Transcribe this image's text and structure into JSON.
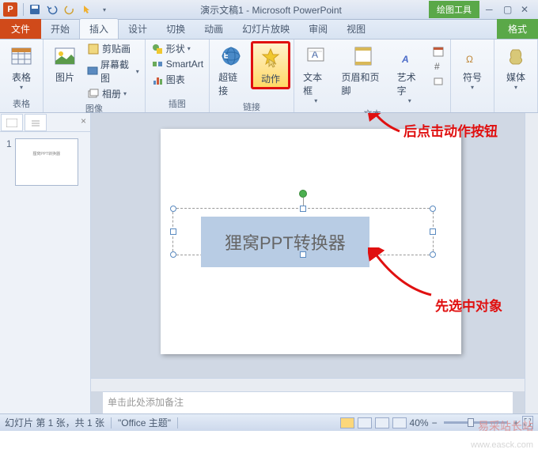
{
  "titlebar": {
    "app_letter": "P",
    "title": "演示文稿1 - Microsoft PowerPoint",
    "drawing_tools": "绘图工具"
  },
  "tabs": {
    "file": "文件",
    "home": "开始",
    "insert": "插入",
    "design": "设计",
    "transitions": "切换",
    "animations": "动画",
    "slideshow": "幻灯片放映",
    "review": "审阅",
    "view": "视图",
    "format": "格式"
  },
  "ribbon": {
    "groups": {
      "tables": {
        "label": "表格",
        "table": "表格"
      },
      "images": {
        "label": "图像",
        "picture": "图片",
        "clipart": "剪贴画",
        "screenshot": "屏幕截图",
        "album": "相册"
      },
      "illustrations": {
        "label": "插图",
        "shapes": "形状",
        "smartart": "SmartArt",
        "chart": "图表"
      },
      "links": {
        "label": "链接",
        "hyperlink": "超链接",
        "action": "动作"
      },
      "text": {
        "label": "文本",
        "textbox": "文本框",
        "headerfooter": "页眉和页脚",
        "wordart": "艺术字"
      },
      "symbols": {
        "label": "",
        "symbol": "符号"
      },
      "media": {
        "label": "",
        "media": "媒体"
      }
    }
  },
  "slide": {
    "textbox_content": "狸窝PPT转换器",
    "thumb_text": "狸窝PPT转换器"
  },
  "annotations": {
    "click_action": "后点击动作按钮",
    "select_object": "先选中对象"
  },
  "notes": {
    "placeholder": "单击此处添加备注"
  },
  "statusbar": {
    "slide_info": "幻灯片 第 1 张，共 1 张",
    "theme": "\"Office 主题\"",
    "zoom": "40%"
  },
  "watermark": {
    "text1": "易采站长站",
    "text2": "www.easck.com"
  },
  "thumb": {
    "num": "1"
  }
}
